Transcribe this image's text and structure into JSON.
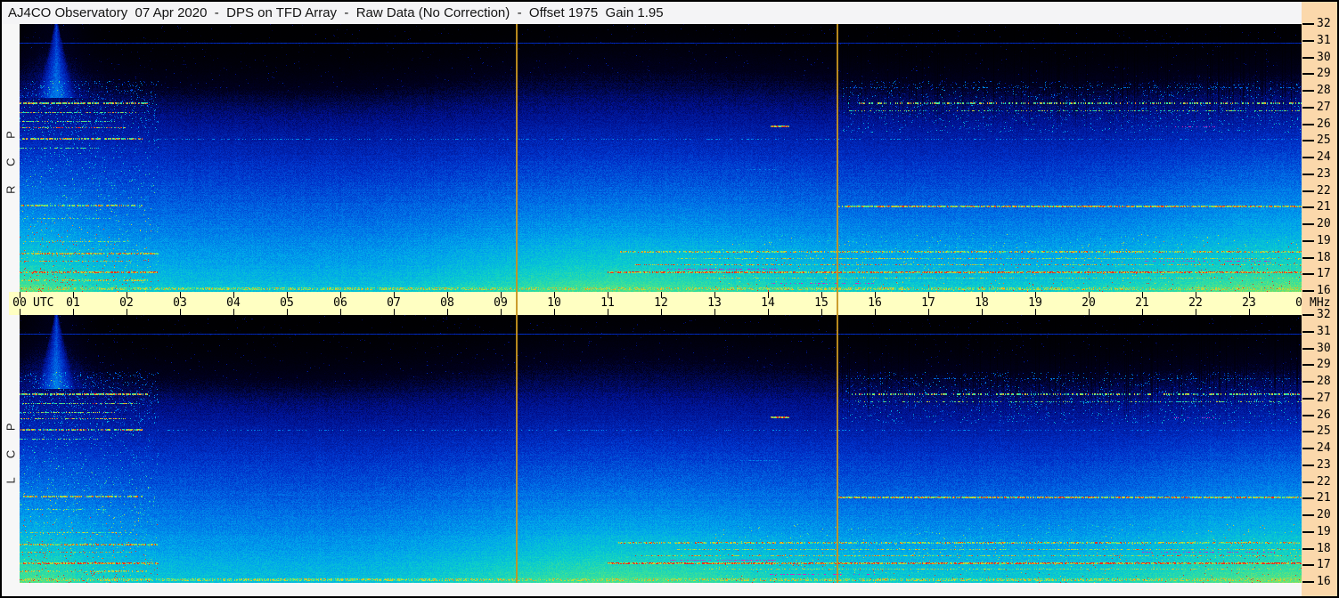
{
  "header": {
    "title": "AJ4CO Observatory  07 Apr 2020  -  DPS on TFD Array  -  Raw Data (No Correction)  -  Offset 1975  Gain 1.95"
  },
  "panels": [
    {
      "id": "rcp",
      "label": "R C P"
    },
    {
      "id": "lcp",
      "label": "L C P"
    }
  ],
  "time_axis": {
    "unit_label": "UTC",
    "hour_labels": [
      "00",
      "01",
      "02",
      "03",
      "04",
      "05",
      "06",
      "07",
      "08",
      "09",
      "10",
      "11",
      "12",
      "13",
      "14",
      "15",
      "16",
      "17",
      "18",
      "19",
      "20",
      "21",
      "22",
      "23",
      "00"
    ]
  },
  "freq_axis": {
    "unit_label": "MHz",
    "tick_labels": [
      "32",
      "31",
      "30",
      "29",
      "28",
      "27",
      "26",
      "25",
      "24",
      "23",
      "22",
      "21",
      "20",
      "19",
      "18",
      "17",
      "16"
    ]
  },
  "colors": {
    "title_bg": "#f4f4f6",
    "time_axis_bg": "#ffffc2",
    "freq_axis_bg": "#fbd8ab",
    "marker_line": "#c79420",
    "page_margin": "#f7f7f7",
    "border": "#000000"
  },
  "chart_data": {
    "type": "heatmap",
    "subtype": "radio-spectrogram",
    "title": "AJ4CO Observatory 07 Apr 2020 - DPS on TFD Array - Raw Data (No Correction) - Offset 1975 Gain 1.95",
    "x_axis": {
      "label": "UTC",
      "unit": "hours",
      "range": [
        0,
        24
      ],
      "tick_step_hours": 1
    },
    "y_axis": {
      "label": "MHz",
      "unit": "MHz",
      "range": [
        16,
        32
      ],
      "tick_step_mhz": 1,
      "inverted": false
    },
    "panels": [
      {
        "label": "R C P",
        "position": "top"
      },
      {
        "label": "L C P",
        "position": "bottom"
      }
    ],
    "marker_lines_utc": [
      9.28,
      15.28
    ],
    "legend": "none",
    "grid": "off",
    "colormap_stops": [
      [
        0.0,
        0,
        0,
        0
      ],
      [
        0.1,
        0,
        0,
        30
      ],
      [
        0.2,
        0,
        16,
        140
      ],
      [
        0.33,
        0,
        48,
        200
      ],
      [
        0.48,
        0,
        110,
        230
      ],
      [
        0.62,
        0,
        165,
        235
      ],
      [
        0.74,
        10,
        205,
        205
      ],
      [
        0.84,
        60,
        225,
        150
      ],
      [
        0.91,
        170,
        225,
        70
      ],
      [
        0.96,
        235,
        200,
        40
      ],
      [
        0.985,
        240,
        130,
        30
      ],
      [
        1.0,
        225,
        45,
        35
      ]
    ],
    "rfi_lines": [
      [
        30.9,
        0,
        24,
        0.3,
        1.0,
        1
      ],
      [
        16.2,
        0,
        24,
        0.88,
        0.85,
        3
      ],
      [
        27.3,
        0,
        2.4,
        0.92,
        0.75,
        2
      ],
      [
        26.7,
        0,
        2.2,
        0.9,
        0.6,
        1
      ],
      [
        26.2,
        0,
        1.8,
        0.88,
        0.55,
        1
      ],
      [
        25.8,
        0,
        2.0,
        0.97,
        0.5,
        1
      ],
      [
        25.15,
        0,
        2.3,
        0.92,
        0.7,
        2
      ],
      [
        24.6,
        0,
        1.5,
        0.85,
        0.5,
        1
      ],
      [
        21.15,
        0,
        2.3,
        0.92,
        0.7,
        2
      ],
      [
        20.4,
        0,
        1.7,
        0.86,
        0.5,
        1
      ],
      [
        19.0,
        0,
        2.1,
        0.88,
        0.55,
        1
      ],
      [
        18.3,
        0,
        2.6,
        0.94,
        0.8,
        2
      ],
      [
        17.8,
        0,
        2.1,
        0.93,
        0.6,
        1
      ],
      [
        17.15,
        0,
        2.6,
        1.0,
        0.85,
        2
      ],
      [
        16.7,
        0,
        2.4,
        0.9,
        0.7,
        2
      ],
      [
        25.1,
        2.5,
        24,
        0.55,
        0.25,
        1
      ],
      [
        21.1,
        15.3,
        24,
        0.94,
        0.9,
        2
      ],
      [
        27.3,
        15.5,
        24,
        0.9,
        0.45,
        2
      ],
      [
        26.8,
        15.5,
        24,
        0.86,
        0.35,
        1
      ],
      [
        28.2,
        15.5,
        24,
        0.5,
        0.2,
        1
      ],
      [
        18.4,
        11.2,
        24,
        0.92,
        0.75,
        2
      ],
      [
        18.0,
        12.3,
        24,
        0.9,
        0.6,
        1
      ],
      [
        17.6,
        11.5,
        24,
        0.93,
        0.65,
        1
      ],
      [
        17.15,
        11.0,
        24,
        1.0,
        0.9,
        2
      ],
      [
        16.8,
        12.8,
        24,
        0.88,
        0.6,
        1
      ],
      [
        19.3,
        13.5,
        24,
        0.6,
        0.25,
        1
      ],
      [
        20.1,
        16.0,
        24,
        0.55,
        0.2,
        1
      ],
      [
        25.9,
        14.05,
        14.4,
        1.0,
        1.0,
        2
      ],
      [
        23.3,
        13.4,
        14.2,
        0.5,
        0.5,
        1
      ]
    ],
    "magenta_lines": [
      [
        17.35,
        12.1,
        14.2,
        0.5
      ],
      [
        17.8,
        21.0,
        23.5,
        0.4
      ],
      [
        25.85,
        21.6,
        22.4,
        0.3
      ],
      [
        16.5,
        14.0,
        16.0,
        0.3
      ]
    ],
    "features": {
      "dark_band_top": "near-black above ~29 MHz, lifting to ~31 MHz around 10-13 UTC",
      "bright_patch_left": "bright cyan-green wash with dense colored RFI streaks 00:00-02:30 UTC",
      "cone_top_left": "narrow bright cone descending from ~31.8 MHz near 00:40 UTC",
      "midday_brightening": "broad cyan brightening below ~24 MHz centered ~11 UTC",
      "evening_brightening": "bright cyan-green wedge at low frequencies after ~21 UTC",
      "speckled_rfi": "speckled interference 26-28.5 MHz after 15:30 UTC and before 02:30 UTC"
    }
  }
}
